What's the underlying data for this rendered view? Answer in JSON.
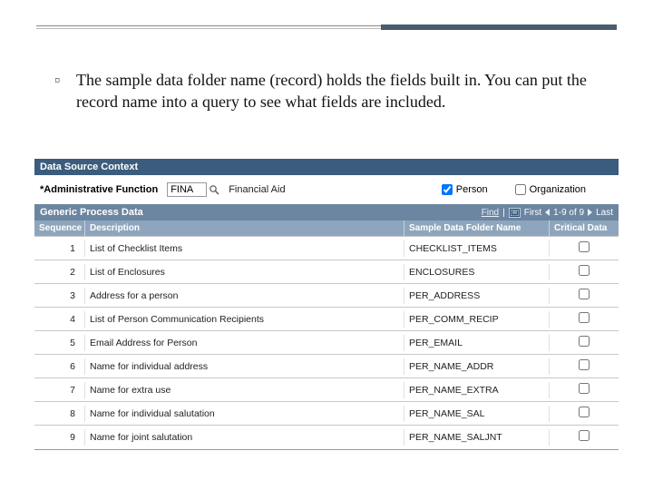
{
  "bullet": {
    "marker": "▫",
    "text": "The sample data folder name (record) holds the fields built in. You can put the record name into a query to see what fields are included."
  },
  "panel": {
    "title": "Data Source Context",
    "admin_label": "*Administrative Function",
    "admin_code": "FINA",
    "admin_desc": "Financial Aid",
    "person_label": "Person",
    "org_label": "Organization"
  },
  "grid": {
    "title": "Generic Process Data",
    "find_label": "Find",
    "first_label": "First",
    "range_label": "1-9 of 9",
    "last_label": "Last",
    "columns": {
      "seq": "Sequence",
      "desc": "Description",
      "folder": "Sample Data Folder Name",
      "crit": "Critical Data"
    },
    "rows": [
      {
        "seq": "1",
        "desc": "List of Checklist Items",
        "folder": "CHECKLIST_ITEMS"
      },
      {
        "seq": "2",
        "desc": "List of Enclosures",
        "folder": "ENCLOSURES"
      },
      {
        "seq": "3",
        "desc": "Address for a person",
        "folder": "PER_ADDRESS"
      },
      {
        "seq": "4",
        "desc": "List of Person Communication Recipients",
        "folder": "PER_COMM_RECIP"
      },
      {
        "seq": "5",
        "desc": "Email Address for Person",
        "folder": "PER_EMAIL"
      },
      {
        "seq": "6",
        "desc": "Name for individual address",
        "folder": "PER_NAME_ADDR"
      },
      {
        "seq": "7",
        "desc": "Name for extra use",
        "folder": "PER_NAME_EXTRA"
      },
      {
        "seq": "8",
        "desc": "Name for individual salutation",
        "folder": "PER_NAME_SAL"
      },
      {
        "seq": "9",
        "desc": "Name for joint salutation",
        "folder": "PER_NAME_SALJNT"
      }
    ]
  }
}
